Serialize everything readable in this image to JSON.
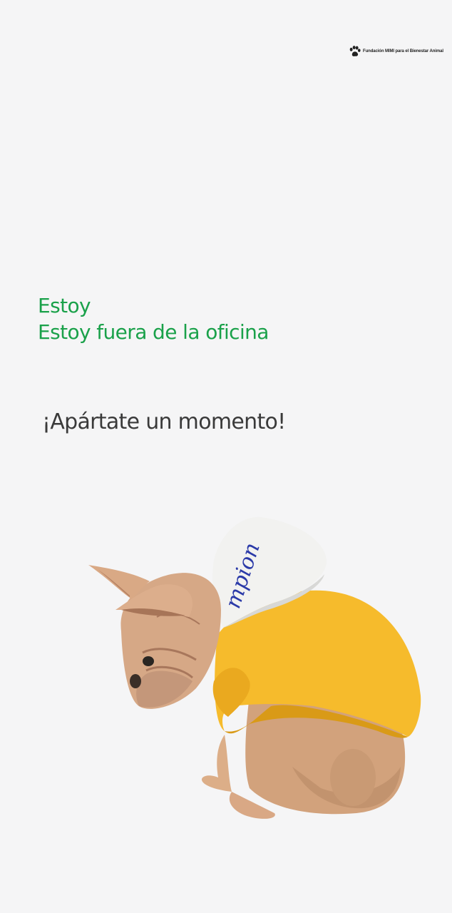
{
  "brand": {
    "text": "Fundación MIMI para el Bienestar Animal",
    "icon": "paw-icon"
  },
  "headline": {
    "line1": "Estoy",
    "line2": "Estoy fuera de la oficina"
  },
  "subhead": "¡Apártate un momento!",
  "photo": {
    "subject": "dog-photo",
    "hood_print": "mpion"
  },
  "colors": {
    "background": "#f5f5f6",
    "headline": "#1aa14a",
    "subhead": "#3a3a3a",
    "hoodie": "#f6bb2c",
    "hood": "#f2f2f0",
    "print": "#2b3aa8"
  }
}
